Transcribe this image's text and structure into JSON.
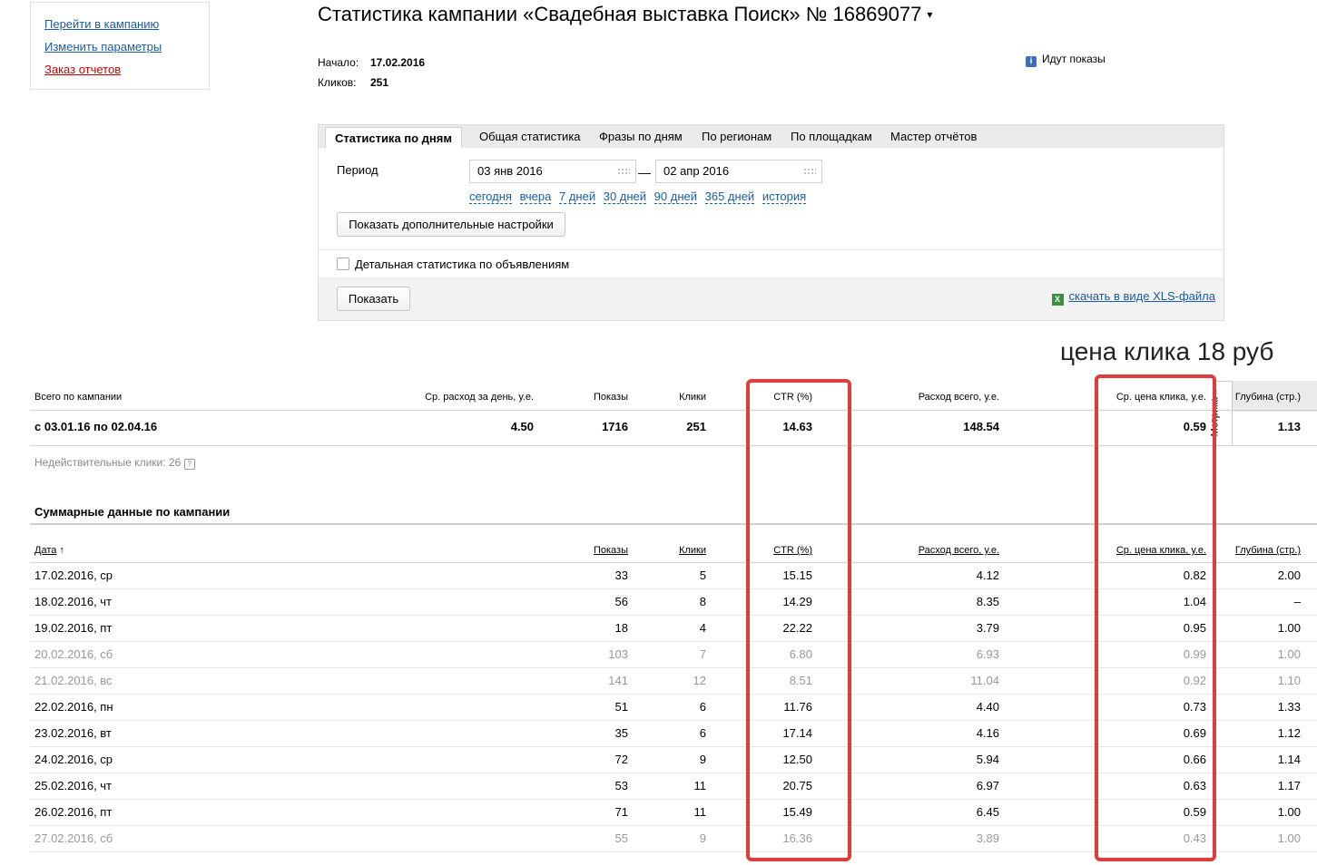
{
  "sidebar": {
    "links": [
      "Перейти в кампанию",
      "Изменить параметры",
      "Заказ отчетов"
    ],
    "colors": {
      "link": "#1a5ca5",
      "order_link": "#cc0000"
    }
  },
  "header": {
    "title": "Статистика кампании «Свадебная выставка Поиск» № 16869077",
    "caret": "▾",
    "start_label": "Начало:",
    "start_value": "17.02.2016",
    "clicks_label": "Кликов:",
    "clicks_value": "251",
    "status_icon": "info-icon",
    "status_icon_glyph": "i",
    "status_text": "Идут показы"
  },
  "tabs": [
    "Статистика по дням",
    "Общая статистика",
    "Фразы по дням",
    "По регионам",
    "По площадкам",
    "Мастер отчётов"
  ],
  "filters": {
    "period_label": "Период",
    "date_from": "03 янв 2016",
    "date_dash": "—",
    "date_to": "02 апр 2016",
    "quick_ranges": [
      "сегодня",
      "вчера",
      "7 дней",
      "30 дней",
      "90 дней",
      "365 дней",
      "история"
    ],
    "extra_settings_label": "Показать дополнительные настройки",
    "detail_checkbox_label": "Детальная статистика по объявлениям",
    "show_button_label": "Показать",
    "xls_icon": "excel-icon",
    "xls_icon_glyph": "X",
    "xls_link_label": "скачать в виде XLS-файла"
  },
  "annotation": "цена клика 18 руб",
  "total": {
    "headers": [
      "Всего по кампании",
      "Ср. расход за день, у.е.",
      "Показы",
      "Клики",
      "CTR (%)",
      "Расход всего, у.е.",
      "Ср. цена клика, у.е.",
      "Глубина (стр.)"
    ],
    "row": [
      "с 03.01.16 по 02.04.16",
      "4.50",
      "1716",
      "251",
      "14.63",
      "148.54",
      "0.59",
      "1.13"
    ],
    "invalid_clicks": "Недействительные клики: 26",
    "help_glyph": "?",
    "metrika_label": "Метрика »"
  },
  "summary": {
    "title": "Суммарные данные по кампании",
    "headers": [
      "Дата",
      "Показы",
      "Клики",
      "CTR (%)",
      "Расход всего, у.е.",
      "Ср. цена клика, у.е.",
      "Глубина (стр.)"
    ],
    "sort_glyph": "↑",
    "rows": [
      [
        "17.02.2016, ср",
        "33",
        "5",
        "15.15",
        "4.12",
        "0.82",
        "2.00"
      ],
      [
        "18.02.2016, чт",
        "56",
        "8",
        "14.29",
        "8.35",
        "1.04",
        "–"
      ],
      [
        "19.02.2016, пт",
        "18",
        "4",
        "22.22",
        "3.79",
        "0.95",
        "1.00"
      ],
      [
        "20.02.2016, сб",
        "103",
        "7",
        "6.80",
        "6.93",
        "0.99",
        "1.00"
      ],
      [
        "21.02.2016, вс",
        "141",
        "12",
        "8.51",
        "11.04",
        "0.92",
        "1.10"
      ],
      [
        "22.02.2016, пн",
        "51",
        "6",
        "11.76",
        "4.40",
        "0.73",
        "1.33"
      ],
      [
        "23.02.2016, вт",
        "35",
        "6",
        "17.14",
        "4.16",
        "0.69",
        "1.12"
      ],
      [
        "24.02.2016, ср",
        "72",
        "9",
        "12.50",
        "5.94",
        "0.66",
        "1.14"
      ],
      [
        "25.02.2016, чт",
        "53",
        "11",
        "20.75",
        "6.97",
        "0.63",
        "1.17"
      ],
      [
        "26.02.2016, пт",
        "71",
        "11",
        "15.49",
        "6.45",
        "0.59",
        "1.00"
      ],
      [
        "27.02.2016, сб",
        "55",
        "9",
        "16.36",
        "3.89",
        "0.43",
        "1.00"
      ]
    ],
    "weekend_rows": [
      3,
      4,
      10
    ]
  },
  "highlight_color": "#e03c3c"
}
